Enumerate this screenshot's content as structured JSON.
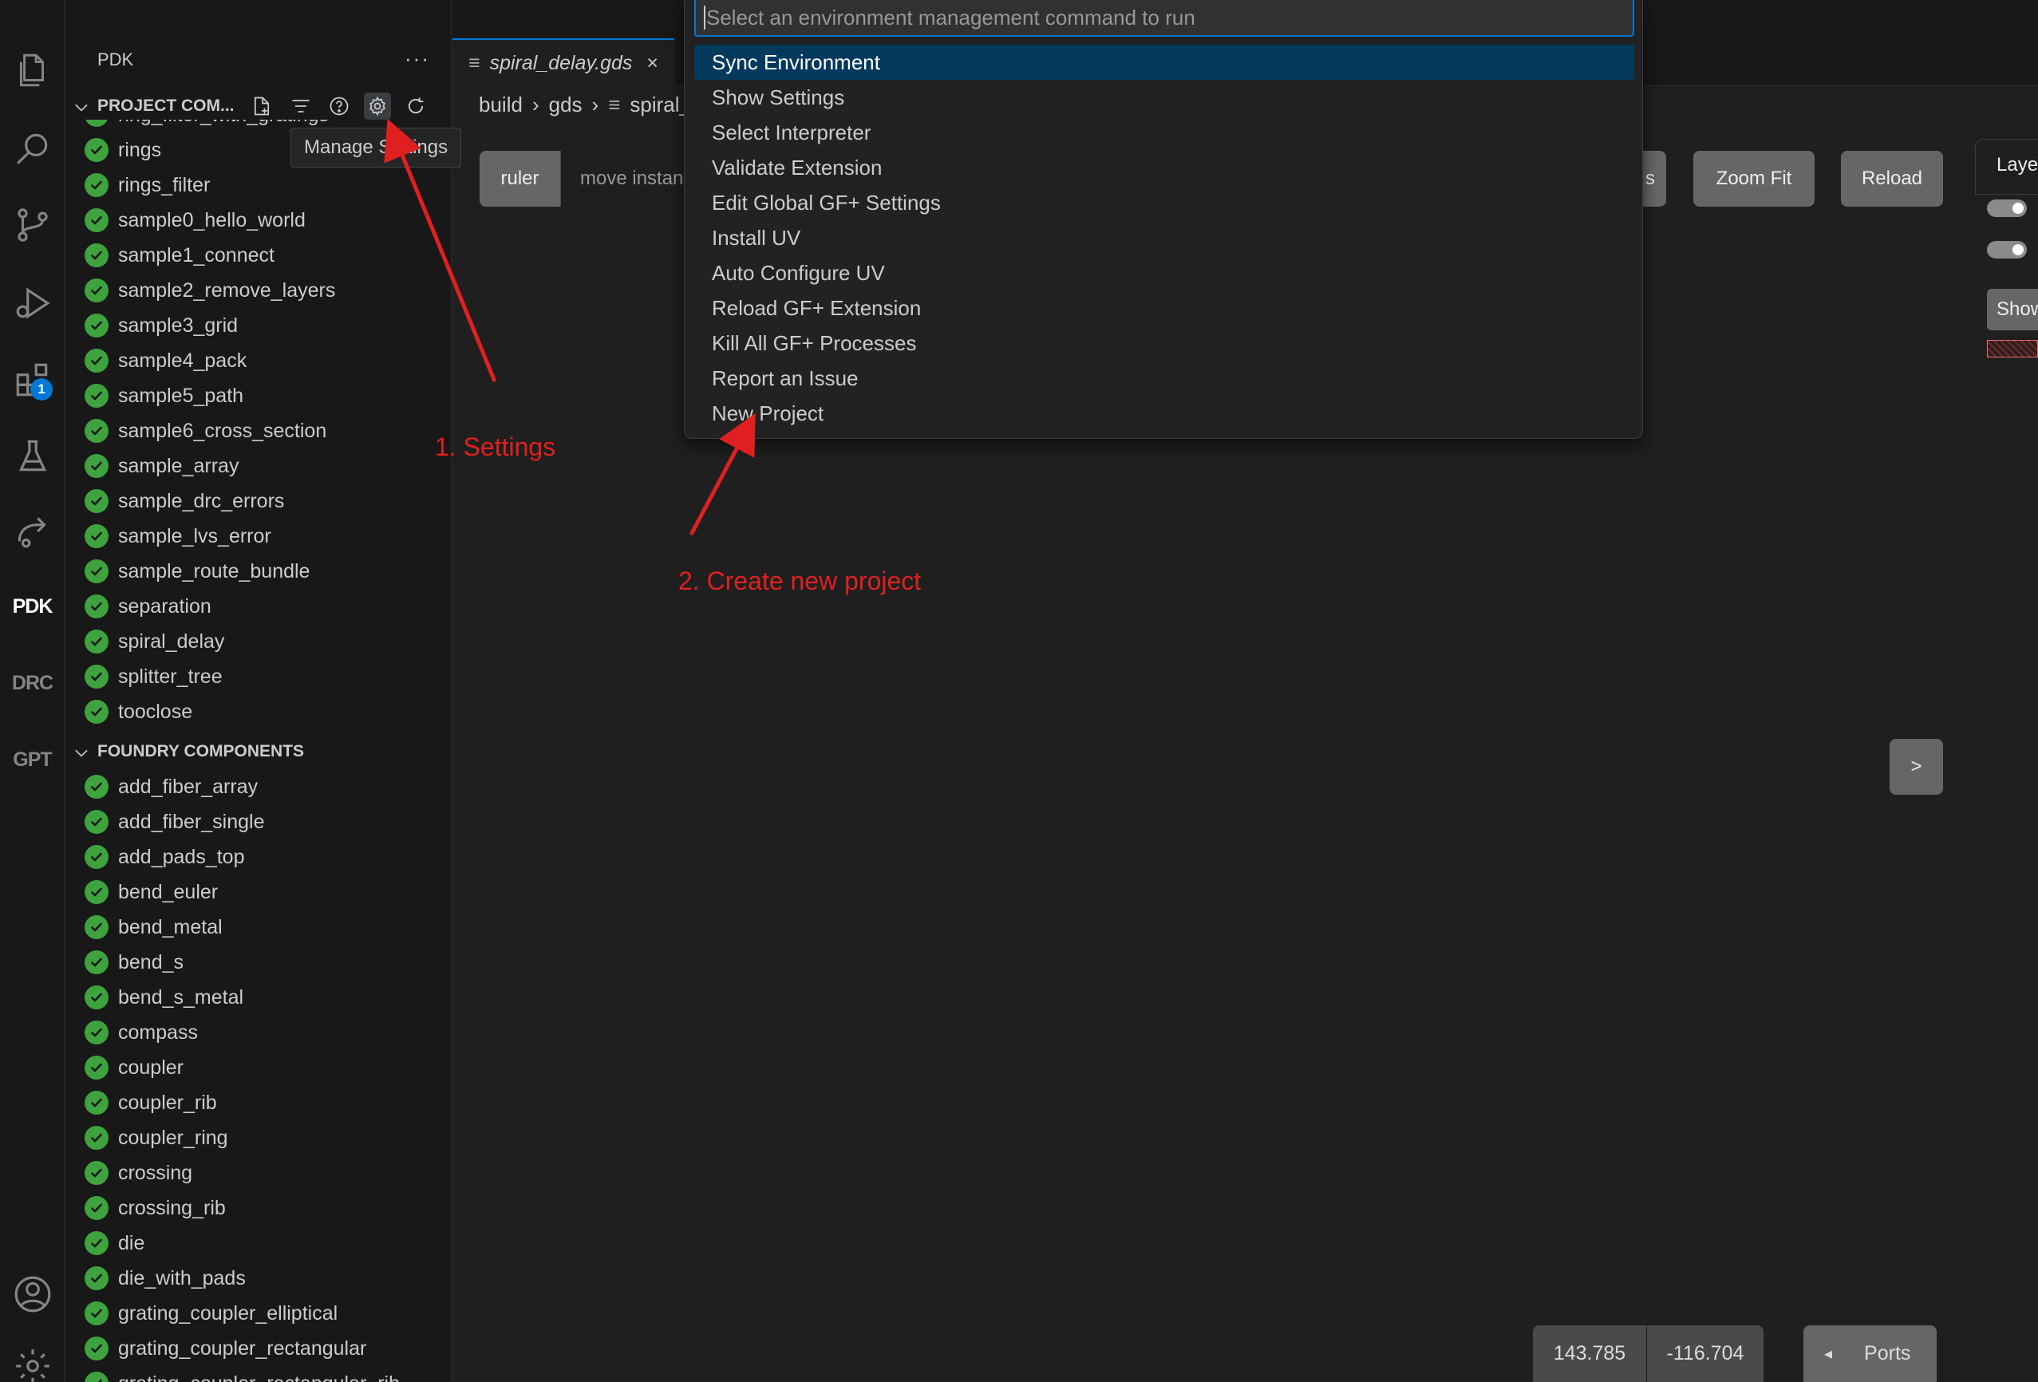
{
  "activity_bar": {
    "items": [
      "explorer-icon",
      "search-icon",
      "source-control-icon",
      "run-debug-icon",
      "extensions-icon",
      "testing-icon",
      "remote-icon"
    ],
    "extensions_badge": "1",
    "text_items": [
      "PDK",
      "DRC",
      "GPT"
    ]
  },
  "sidebar": {
    "title": "PDK",
    "more": "···",
    "project_section": {
      "title": "PROJECT COM...",
      "items": [
        "ring_filter_with_gratings",
        "rings",
        "rings_filter",
        "sample0_hello_world",
        "sample1_connect",
        "sample2_remove_layers",
        "sample3_grid",
        "sample4_pack",
        "sample5_path",
        "sample6_cross_section",
        "sample_array",
        "sample_drc_errors",
        "sample_lvs_error",
        "sample_route_bundle",
        "separation",
        "spiral_delay",
        "splitter_tree",
        "tooclose"
      ]
    },
    "foundry_section": {
      "title": "FOUNDRY COMPONENTS",
      "items": [
        "add_fiber_array",
        "add_fiber_single",
        "add_pads_top",
        "bend_euler",
        "bend_metal",
        "bend_s",
        "bend_s_metal",
        "compass",
        "coupler",
        "coupler_rib",
        "coupler_ring",
        "crossing",
        "crossing_rib",
        "die",
        "die_with_pads",
        "grating_coupler_elliptical",
        "grating_coupler_rectangular",
        "grating_coupler_rectangular_rib"
      ]
    },
    "tooltip": "Manage Settings"
  },
  "editor": {
    "tab_label": "spiral_delay.gds",
    "tab_close": "×",
    "breadcrumb": [
      "build",
      "gds",
      "spiral_delay.gds"
    ],
    "toolbar": {
      "ruler": "ruler",
      "move": "move instance",
      "hidden_end": "s",
      "zoom_fit": "Zoom Fit",
      "reload": "Reload"
    },
    "layers_tab": "Layers",
    "show_button": "Show",
    "nav_button": ">",
    "coord_x": "143.785",
    "coord_y": "-116.704",
    "ports_label": "Ports",
    "ports_arrow": "◂"
  },
  "quick_pick": {
    "placeholder": "Select an environment management command to run",
    "items": [
      "Sync Environment",
      "Show Settings",
      "Select Interpreter",
      "Validate Extension",
      "Edit Global GF+ Settings",
      "Install UV",
      "Auto Configure UV",
      "Reload GF+ Extension",
      "Kill All GF+ Processes",
      "Report an Issue",
      "New Project"
    ],
    "selected_index": 0
  },
  "annotations": {
    "step1": "1. Settings",
    "step2": "2. Create new project",
    "color": "#e02020"
  },
  "colors": {
    "accent": "#0078d4",
    "check": "#3ea33e",
    "selection": "#04395e"
  }
}
